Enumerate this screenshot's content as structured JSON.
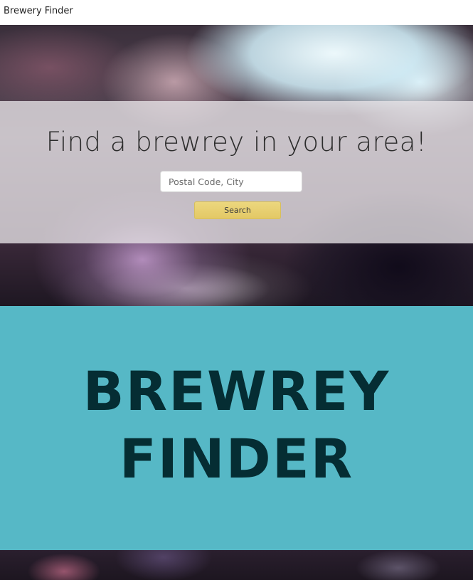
{
  "navbar": {
    "brand": "Brewery Finder"
  },
  "hero": {
    "title": "Find a brewrey in your area!",
    "search": {
      "placeholder": "Postal Code, City",
      "value": ""
    },
    "search_button_label": "Search"
  },
  "banner": {
    "line1": "BREWREY",
    "line2": "FINDER"
  },
  "colors": {
    "teal_section": "#56b8c6",
    "banner_text": "#052d33",
    "search_button": "#e6cd6e",
    "hero_overlay": "#e8e4e8"
  }
}
